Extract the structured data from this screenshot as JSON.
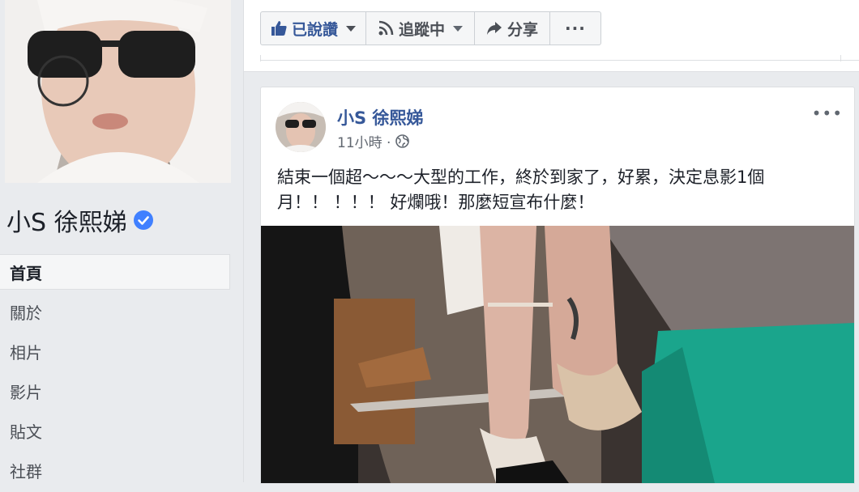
{
  "profile": {
    "name": "小S 徐熙娣",
    "nav": [
      {
        "label": "首頁",
        "active": true
      },
      {
        "label": "關於"
      },
      {
        "label": "相片"
      },
      {
        "label": "影片"
      },
      {
        "label": "貼文"
      },
      {
        "label": "社群"
      }
    ]
  },
  "actions": {
    "like_label": "已說讚",
    "follow_label": "追蹤中",
    "share_label": "分享",
    "more_label": "···"
  },
  "post": {
    "author": "小S 徐熙娣",
    "time": "11小時 ·",
    "menu_label": "•••",
    "text": "結束一個超～～～大型的工作，終於到家了，好累，決定息影1個\n月！！ ！！！ 好爛哦！那麼短宣布什麼！"
  },
  "colors": {
    "link_blue": "#365899",
    "verified_blue": "#4080ff",
    "page_bg": "#e9ebee"
  },
  "icons": {
    "like": "thumbs-up-icon",
    "follow": "rss-icon",
    "share": "share-arrow-icon",
    "privacy": "globe-icon",
    "verified": "verified-badge-icon"
  }
}
